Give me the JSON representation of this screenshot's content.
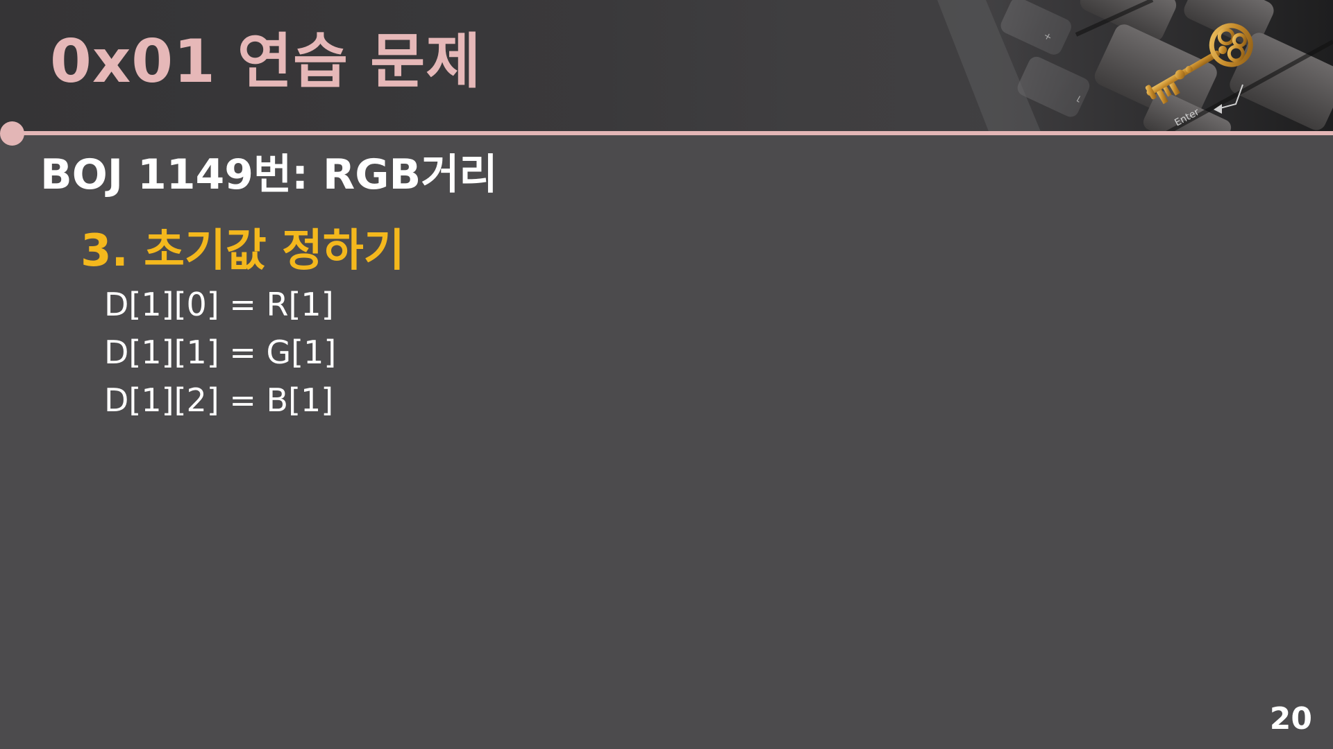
{
  "slide": {
    "title": "0x01  연습 문제",
    "subtitle": "BOJ 1149번: RGB거리",
    "section_heading": "3. 초기값 정하기",
    "code_lines": [
      "D[1][0] = R[1]",
      "D[1][1] = G[1]",
      "D[1][2] = B[1]"
    ],
    "page_number": "20"
  },
  "header_image": {
    "key_label": "Enter"
  },
  "colors": {
    "background": "#4c4b4d",
    "header": "#353436",
    "title_pink": "#e6b8b8",
    "divider_pink": "#e3b6b6",
    "heading_gold": "#f4b81d",
    "text_white": "#ffffff"
  }
}
